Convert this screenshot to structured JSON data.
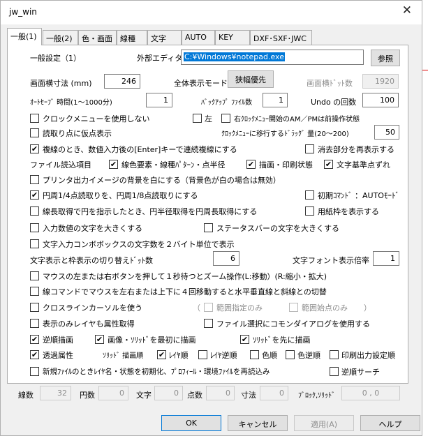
{
  "window": {
    "title": "jw_win",
    "close": "✕"
  },
  "tabs": [
    "一般(1)",
    "一般(2)",
    "色・画面",
    "線種",
    "文字",
    "AUTO",
    "KEY",
    "DXF･SXF･JWC"
  ],
  "general": {
    "heading": "一般設定（1）",
    "editor_label": "外部エディタ",
    "editor_value": "C:¥Windows¥notepad.exe",
    "browse_button": "参照",
    "width_label": "画面横寸法 (mm)",
    "width_value": "246",
    "fullview_label": "全体表示モード",
    "fullview_button": "狭幅優先",
    "dots_label": "画面横ﾄﾞｯﾄ数",
    "dots_value": "1920",
    "autosave_label": "ｵｰﾄｾｰﾌﾞ 時間(1〜1000分)",
    "autosave_value": "1",
    "backup_label": "ﾊﾞｯｸｱｯﾌﾟ ﾌｧｲﾙ数",
    "backup_value": "1",
    "undo_label": "Undo の回数",
    "undo_value": "100",
    "clock_menu_label": "クロックメニューを使用しない",
    "left_label": "左",
    "ampm_label": "右ｸﾛｯｸﾒﾆｭｰ開始のAM／PMは前操作状態",
    "tentative_label": "読取り点に仮点表示",
    "drag_label": "ｸﾛｯｸﾒﾆｭｰに移行するﾄﾞﾗｯｸﾞ 量(20〜200)",
    "drag_value": "50",
    "copy_label": "複線のとき、数値入力後の[Enter]キーで連続複線にする",
    "redisplay_label": "消去部分を再表示する",
    "file_items_label": "ファイル読込項目",
    "linecolor_label": "線色要素・線種ﾊﾟﾀｰﾝ・点半径",
    "print_state_label": "描画・印刷状態",
    "text_base_label": "文字基準点ずれ",
    "printer_bg_label": "プリンタ出力イメージの背景を白にする（背景色が白の場合は無効）",
    "arc_label": "円周1/4点読取りを、円周1/8点読取りにする",
    "initial_cmd_label": "初期ｺﾏﾝﾄﾞ ：AUTOﾓｰﾄﾞ",
    "line_length_label": "線長取得で円を指示したとき、円半径取得を円周長取得にする",
    "paper_frame_label": "用紙枠を表示する",
    "input_big_label": "入力数値の文字を大きくする",
    "status_big_label": "ステータスバーの文字を大きくする",
    "combo_label": "文字入力コンボボックスの文字数を２バイト単位で表示",
    "dot_switch_label": "文字表示と枠表示の切り替えﾄﾞｯﾄ数",
    "dot_switch_value": "6",
    "font_scale_label": "文字フォント表示倍率",
    "font_scale_value": "1",
    "mouse_zoom_label": "マウスの左または右ボタンを押して１秒待つとズーム操作(L:移動）(R:縮小・拡大)",
    "line_cmd_label": "線コマンドでマウスを左右または上下に４回移動すると水平垂直線と斜線との切替",
    "crossline_label": "クロスラインカーソルを使う",
    "range_only_label": "範囲指定のみ",
    "range_start_label": "範囲始点のみ",
    "layer_attr_label": "表示のみレイヤも属性取得",
    "common_dialog_label": "ファイル選択にコモンダイアログを使用する",
    "reverse_draw_label": "逆順描画",
    "image_first_label": "画像・ｿﾘｯﾄﾞを最初に描画",
    "solid_first_label": "ｿﾘｯﾄﾞを先に描画",
    "transparent_label": "透過属性",
    "solid_order_label": "ｿﾘｯﾄﾞ 描画順",
    "layer_order_label": "ﾚｲﾔ順",
    "layer_rev_label": "ﾚｲﾔ逆順",
    "color_order_label": "色順",
    "color_rev_label": "色逆順",
    "print_order_label": "印刷出力設定順",
    "new_file_label": "新規ﾌｧｲﾙのときﾚｲﾔ名・状態を初期化、ﾌﾟﾛﾌｨｰﾙ・環境ﾌｧｲﾙを再読込み",
    "reverse_search_label": "逆順サーチ",
    "paren_open": "（",
    "paren_close": "）"
  },
  "counts": {
    "lines_label": "線数",
    "lines_value": "32",
    "circles_label": "円数",
    "circles_value": "0",
    "text_label": "文字",
    "text_value": "0",
    "points_label": "点数",
    "points_value": "0",
    "dims_label": "寸法",
    "dims_value": "0",
    "blocks_label": "ﾌﾞﾛｯｸ,ｿﾘｯﾄﾞ",
    "blocks_value": "0 , 0"
  },
  "buttons": {
    "ok": "OK",
    "cancel": "キャンセル",
    "apply": "適用(A)",
    "help": "ヘルプ"
  },
  "checkmark": "✔"
}
